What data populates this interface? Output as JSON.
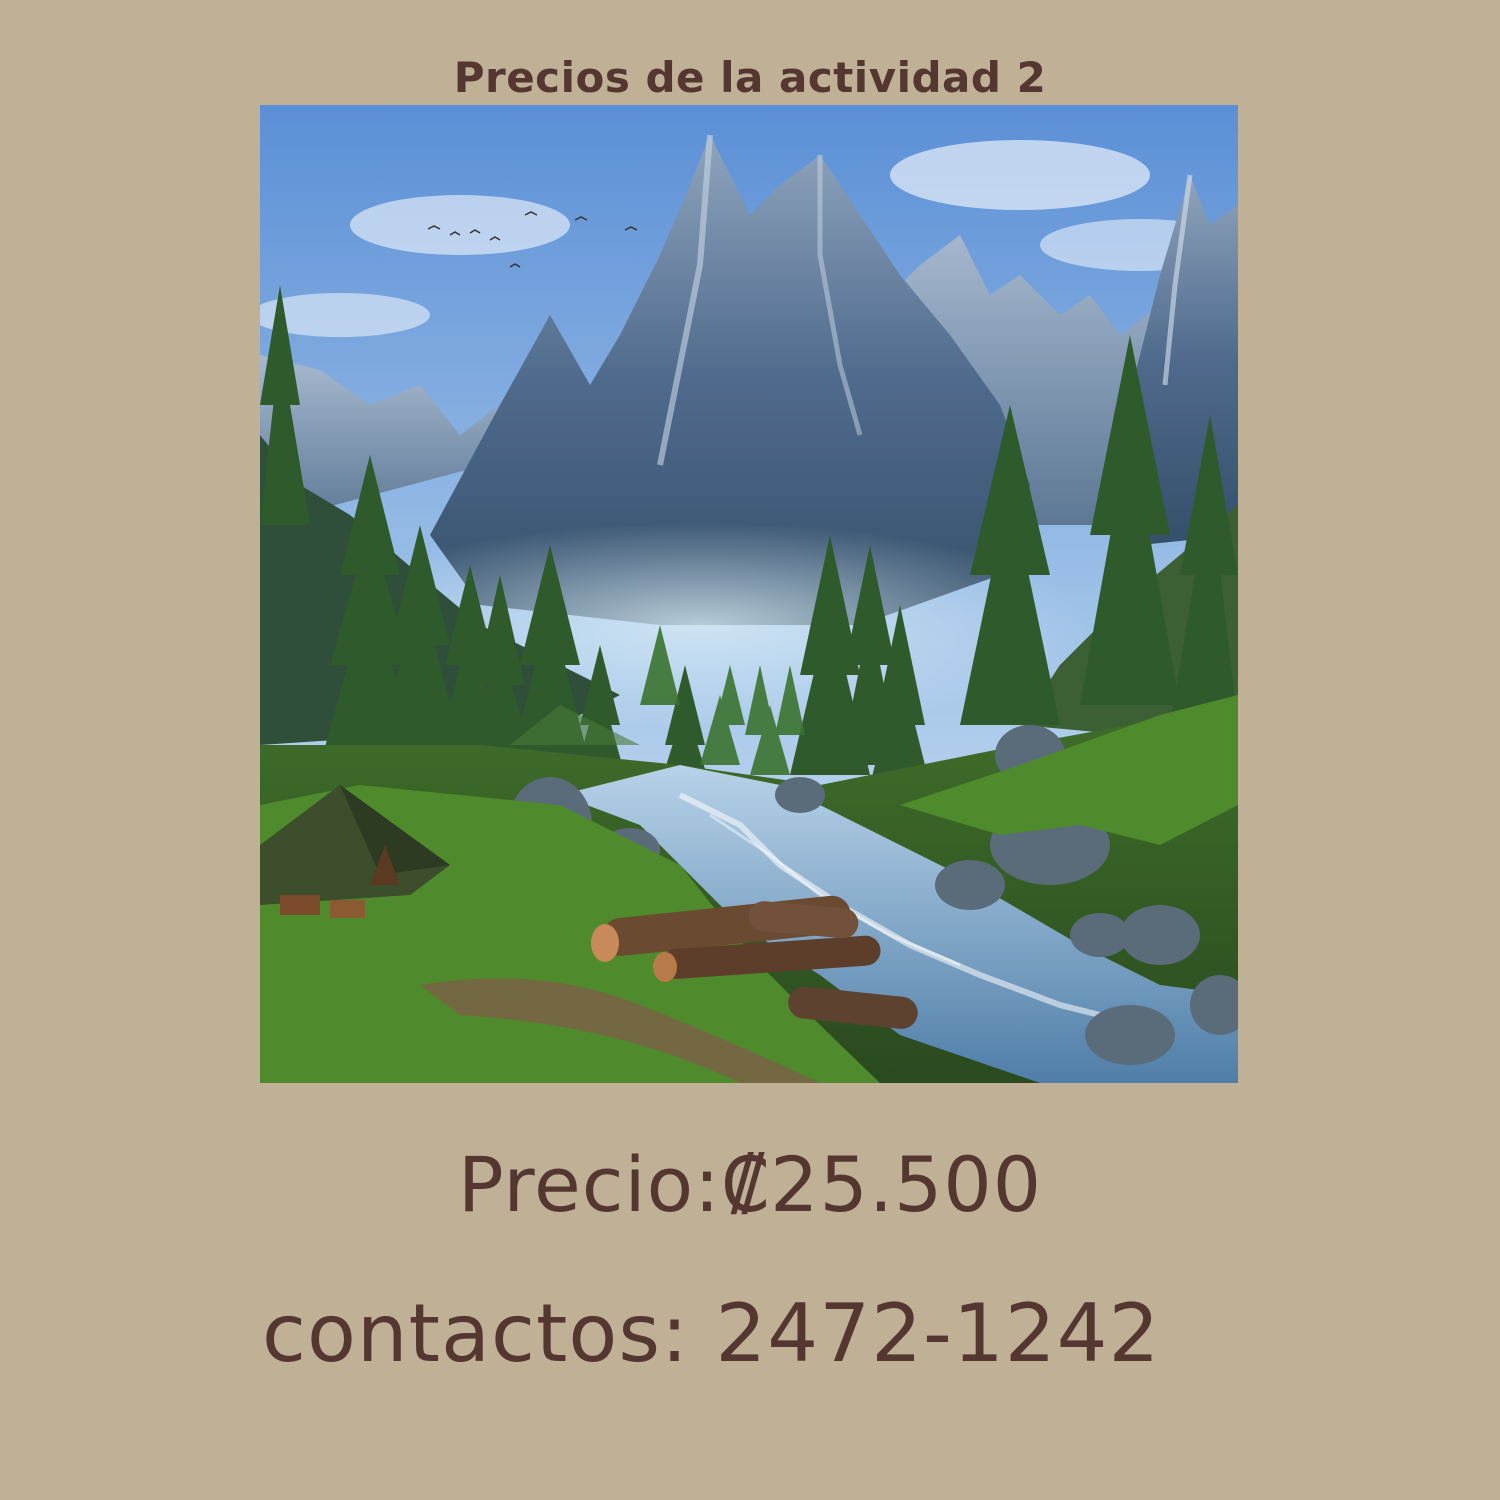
{
  "title": "Precios de la actividad 2",
  "image": {
    "icon": "landscape-photo-icon",
    "palette": {
      "sky_top": "#5b8fd6",
      "sky_bottom": "#cfe2f2",
      "rock": "#4f6a8c",
      "forest": "#2f5b2c",
      "water": "#8fb6d6",
      "grass": "#4f8a2c"
    }
  },
  "price": {
    "label": "Precio:",
    "currency": "₡",
    "amount": "25.500"
  },
  "contact": {
    "label": "contactos:",
    "phone": "2472-1242"
  },
  "colors": {
    "background": "#bfb096",
    "text": "#553731"
  }
}
